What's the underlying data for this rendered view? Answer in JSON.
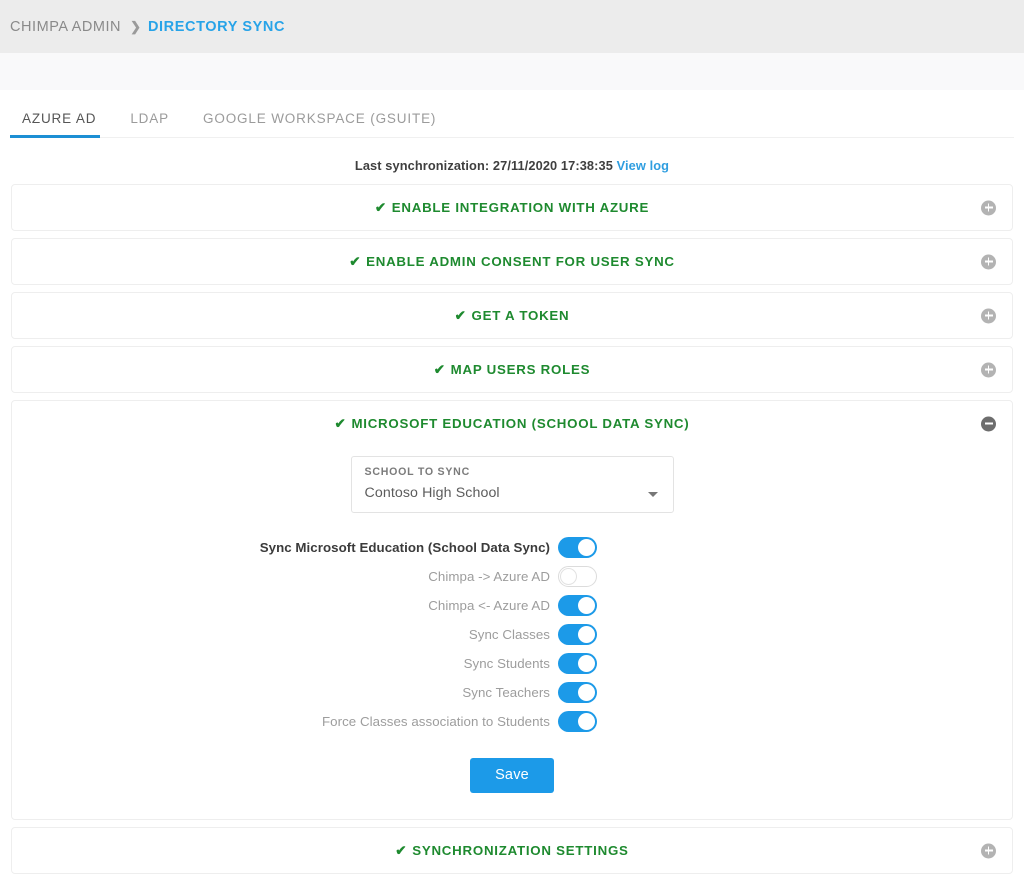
{
  "breadcrumb": {
    "root": "CHIMPA ADMIN",
    "separator": "❯",
    "current": "DIRECTORY SYNC"
  },
  "tabs": [
    {
      "label": "AZURE AD",
      "active": true
    },
    {
      "label": "LDAP",
      "active": false
    },
    {
      "label": "GOOGLE WORKSPACE (GSUITE)",
      "active": false
    }
  ],
  "last_sync": {
    "prefix": "Last synchronization: 27/11/2020 17:38:35",
    "link": "View log"
  },
  "sections": [
    {
      "title": "ENABLE INTEGRATION WITH AZURE",
      "check": "✔",
      "expanded": false,
      "icon": "plus-circle-icon"
    },
    {
      "title": "ENABLE ADMIN CONSENT FOR USER SYNC",
      "check": "✔",
      "expanded": false,
      "icon": "plus-circle-icon"
    },
    {
      "title": "GET A TOKEN",
      "check": "✔",
      "expanded": false,
      "icon": "plus-circle-icon"
    },
    {
      "title": "MAP USERS ROLES",
      "check": "✔",
      "expanded": false,
      "icon": "plus-circle-icon"
    },
    {
      "title": "MICROSOFT EDUCATION (SCHOOL DATA SYNC)",
      "check": "✔",
      "expanded": true,
      "icon": "minus-circle-icon"
    },
    {
      "title": "SYNCHRONIZATION SETTINGS",
      "check": "✔",
      "expanded": false,
      "icon": "plus-circle-icon"
    }
  ],
  "school_select": {
    "label": "SCHOOL TO SYNC",
    "value": "Contoso High School",
    "caret": "chevron-down-icon"
  },
  "switches": [
    {
      "label": "Sync Microsoft Education (School Data Sync)",
      "on": true,
      "primary": true
    },
    {
      "label": "Chimpa -> Azure AD",
      "on": false,
      "primary": false
    },
    {
      "label": "Chimpa <- Azure AD",
      "on": true,
      "primary": false
    },
    {
      "label": "Sync Classes",
      "on": true,
      "primary": false
    },
    {
      "label": "Sync Students",
      "on": true,
      "primary": false
    },
    {
      "label": "Sync Teachers",
      "on": true,
      "primary": false
    },
    {
      "label": "Force Classes association to Students",
      "on": true,
      "primary": false
    }
  ],
  "save_button": "Save",
  "colors": {
    "accent_blue": "#1c9ae8",
    "tab_underline": "#1c8fd4",
    "section_green": "#1e8a2f",
    "breadcrumb_link": "#27a3e8",
    "topbar_bg": "#ececec"
  }
}
